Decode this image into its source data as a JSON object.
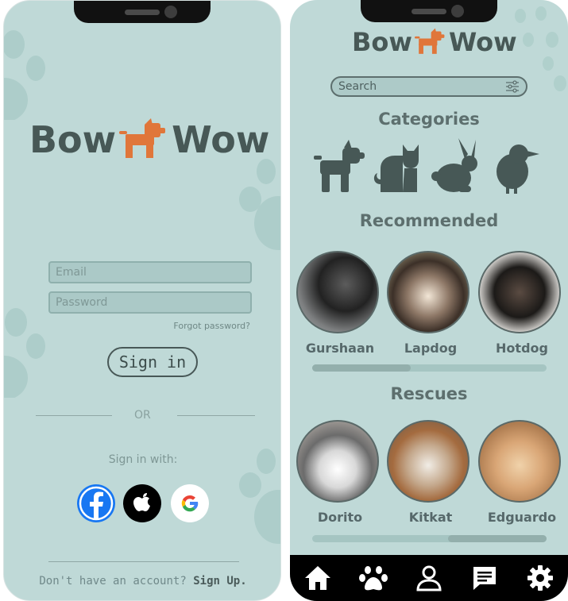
{
  "login": {
    "logo_left": "Bow",
    "logo_right": "Wow",
    "email_placeholder": "Email",
    "password_placeholder": "Password",
    "forgot": "Forgot password?",
    "signin": "Sign in",
    "or": "OR",
    "sign_with": "Sign in with:",
    "no_account": "Don't have an account?",
    "signup": "Sign Up."
  },
  "home": {
    "logo_left": "Bow",
    "logo_right": "Wow",
    "search_placeholder": "Search",
    "categories_title": "Categories",
    "categories": [
      "dog-icon",
      "cat-icon",
      "rabbit-icon",
      "bird-icon"
    ],
    "recommended_title": "Recommended",
    "recommended": [
      {
        "name": "Gurshaan"
      },
      {
        "name": "Lapdog"
      },
      {
        "name": "Hotdog"
      }
    ],
    "rescues_title": "Rescues",
    "rescues": [
      {
        "name": "Dorito"
      },
      {
        "name": "Kitkat"
      },
      {
        "name": "Edguardo"
      }
    ],
    "recommended_scroll_fraction": 0.42,
    "rescues_scroll_fraction": 0.42,
    "nav": [
      "home-icon",
      "paw-icon",
      "profile-icon",
      "chat-icon",
      "settings-icon"
    ]
  },
  "colors": {
    "background": "#bfd9d7",
    "accent_orange": "#e0763a",
    "text_dark": "#475856",
    "facebook": "#1877f2"
  }
}
